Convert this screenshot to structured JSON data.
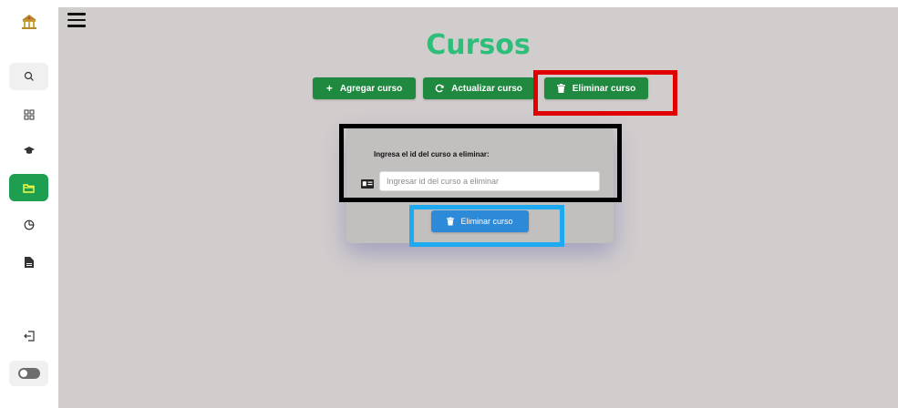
{
  "sidebar": {
    "logo_icon": "university-building-icon",
    "items": [
      {
        "name": "search",
        "icon": "search-icon",
        "glyph": "⌕"
      },
      {
        "name": "dashboard",
        "icon": "grid-icon",
        "glyph": "▦"
      },
      {
        "name": "graduation",
        "icon": "graduation-cap-icon",
        "glyph": "🎓"
      },
      {
        "name": "courses",
        "icon": "folder-icon",
        "glyph": "🗀",
        "active": true
      },
      {
        "name": "reports",
        "icon": "pie-chart-icon",
        "glyph": "◷"
      },
      {
        "name": "documents",
        "icon": "file-icon",
        "glyph": "🗎"
      },
      {
        "name": "logout",
        "icon": "logout-icon",
        "glyph": "⇤"
      }
    ],
    "theme_toggle_icon": "toggle-icon"
  },
  "header": {
    "menu_icon": "hamburger-icon",
    "title": "Cursos"
  },
  "actions": {
    "add_label": "Agregar curso",
    "update_label": "Actualizar curso",
    "delete_label": "Eliminar curso"
  },
  "delete_form": {
    "label": "Ingresa el id del curso a eliminar:",
    "input_value": "",
    "input_placeholder": "Ingresar id del curso a eliminar",
    "submit_label": "Eliminar curso"
  },
  "colors": {
    "accent_green": "#1f8a3f",
    "title_green": "#2bbf7a",
    "primary_blue": "#2d8ad8",
    "highlight_red": "#e00000",
    "highlight_black": "#000000",
    "highlight_cyan": "#1eaaf0",
    "background": "#d1cdcd"
  }
}
